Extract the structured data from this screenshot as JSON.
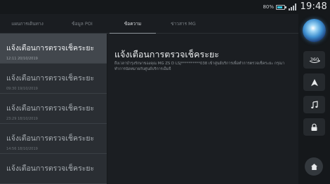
{
  "status_bar": {
    "battery_percent": "80%",
    "clock": "19:48"
  },
  "tabs": [
    {
      "label": "แผนการเดินทาง",
      "active": false
    },
    {
      "label": "ข้อมูล POI",
      "active": false
    },
    {
      "label": "ข้อความ",
      "active": true
    },
    {
      "label": "ข่าวสาร MG",
      "active": false
    }
  ],
  "messages": [
    {
      "title": "แจ้งเตือนการตรวจเช็คระยะ",
      "time": "12:11 20/10/2019",
      "selected": true
    },
    {
      "title": "แจ้งเตือนการตรวจเช็คระยะ",
      "time": "09:30 19/10/2019",
      "selected": false
    },
    {
      "title": "แจ้งเตือนการตรวจเช็คระยะ",
      "time": "23:29 18/10/2019",
      "selected": false
    },
    {
      "title": "แจ้งเตือนการตรวจเช็คระยะ",
      "time": "14:56 18/10/2019",
      "selected": false
    },
    {
      "title": "แจ้งเตือนการตรวจเช็คระยะ",
      "time": "",
      "selected": false
    }
  ],
  "detail": {
    "title": "แจ้งเตือนการตรวจเช็คระยะ",
    "body": "ถึงเวลาบำรุงรักษาของคุณ MG ZS D LSJ**********038 เข้าศูนย์บริการเพื่อทำการตรวจเช็คระยะ กรุณาทำการนัดหมายกับศูนย์บริการเอ็มจี"
  },
  "side_rail": {
    "icons": [
      "assistant-orb",
      "360-camera-icon",
      "navigation-arrow-icon",
      "music-note-icon",
      "lock-icon",
      "home-icon"
    ],
    "camera_label": "360"
  },
  "colors": {
    "background": "#15181b",
    "list_bg": "#2a2e33",
    "selected_bg": "#42474d",
    "battery_accent": "#34c6e0"
  }
}
